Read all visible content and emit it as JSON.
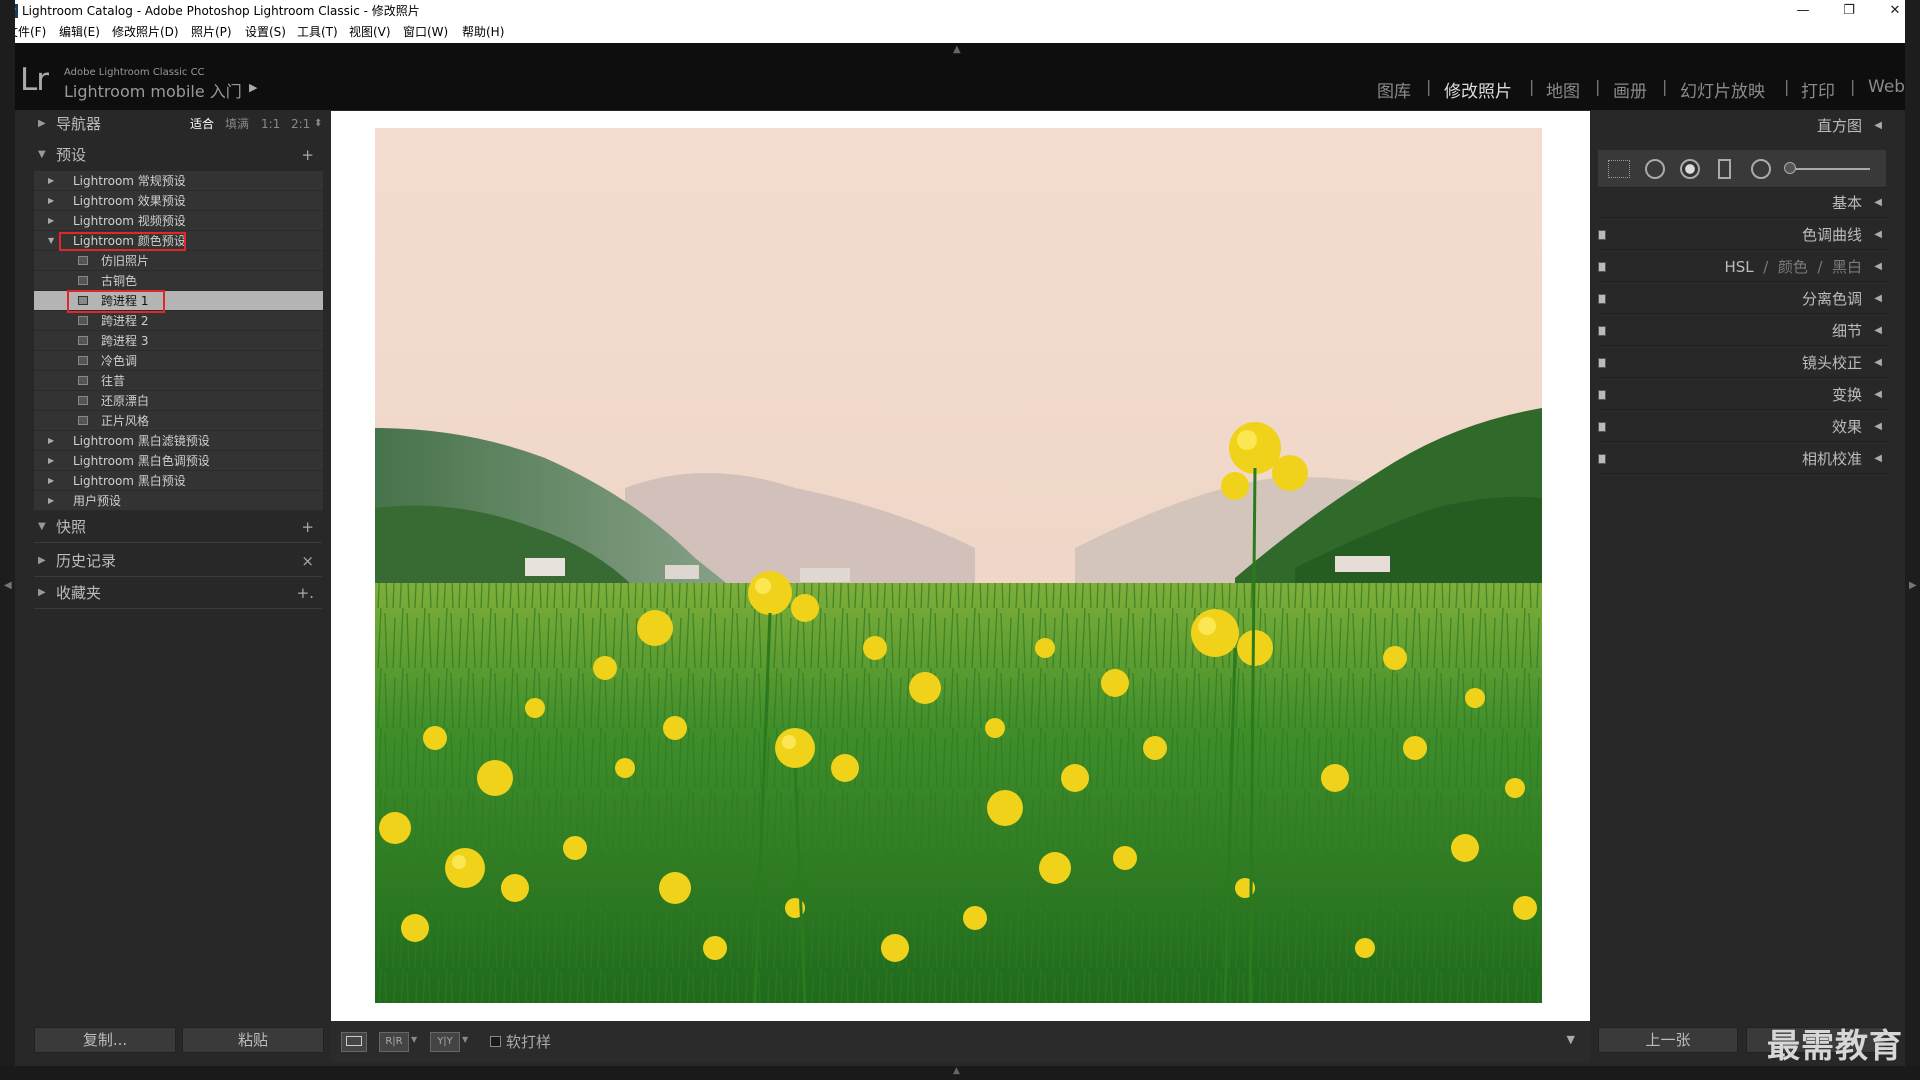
{
  "window": {
    "title": "Lightroom Catalog - Adobe Photoshop Lightroom Classic - 修改照片",
    "minimize_icon": "minimize-icon",
    "restore_icon": "restore-icon",
    "close_icon": "close-icon"
  },
  "menu": [
    "文件(F)",
    "编辑(E)",
    "修改照片(D)",
    "照片(P)",
    "设置(S)",
    "工具(T)",
    "视图(V)",
    "窗口(W)",
    "帮助(H)"
  ],
  "identity": {
    "logo": "Lr",
    "product": "Adobe Lightroom Classic CC",
    "mobile": "Lightroom mobile 入门"
  },
  "modules": [
    "图库",
    "修改照片",
    "地图",
    "画册",
    "幻灯片放映",
    "打印",
    "Web"
  ],
  "active_module": "修改照片",
  "left": {
    "navigator": {
      "label": "导航器",
      "opts": [
        "适合",
        "填满",
        "1:1",
        "2:1"
      ]
    },
    "presets": {
      "label": "预设",
      "add": "+"
    },
    "preset_items": [
      {
        "label": "Lightroom 常规预设",
        "type": "folder"
      },
      {
        "label": "Lightroom 效果预设",
        "type": "folder"
      },
      {
        "label": "Lightroom 视频预设",
        "type": "folder"
      },
      {
        "label": "Lightroom 颜色预设",
        "type": "folder-open",
        "highlight": true
      },
      {
        "label": "仿旧照片",
        "type": "item"
      },
      {
        "label": "古铜色",
        "type": "item"
      },
      {
        "label": "跨进程 1",
        "type": "item",
        "selected": true,
        "highlight": true
      },
      {
        "label": "跨进程 2",
        "type": "item"
      },
      {
        "label": "跨进程 3",
        "type": "item"
      },
      {
        "label": "冷色调",
        "type": "item"
      },
      {
        "label": "往昔",
        "type": "item"
      },
      {
        "label": "还原漂白",
        "type": "item"
      },
      {
        "label": "正片风格",
        "type": "item"
      },
      {
        "label": "Lightroom 黑白滤镜预设",
        "type": "folder"
      },
      {
        "label": "Lightroom 黑白色调预设",
        "type": "folder"
      },
      {
        "label": "Lightroom 黑白预设",
        "type": "folder"
      },
      {
        "label": "用户预设",
        "type": "folder"
      }
    ],
    "snapshots": {
      "label": "快照",
      "add": "+"
    },
    "history": {
      "label": "历史记录",
      "clear": "×"
    },
    "collections": {
      "label": "收藏夹",
      "add": "+."
    },
    "copy_button": "复制...",
    "paste_button": "粘贴"
  },
  "right": {
    "panels": [
      {
        "label": "直方图",
        "switch": false
      },
      {
        "label": "基本",
        "switch": false
      },
      {
        "label": "色调曲线",
        "switch": true
      },
      {
        "label": "HSL",
        "switch": true,
        "extra": [
          "颜色",
          "黑白"
        ]
      },
      {
        "label": "分离色调",
        "switch": true
      },
      {
        "label": "细节",
        "switch": true
      },
      {
        "label": "镜头校正",
        "switch": true
      },
      {
        "label": "变换",
        "switch": true
      },
      {
        "label": "效果",
        "switch": true
      },
      {
        "label": "相机校准",
        "switch": true
      }
    ],
    "prev_button": "上一张"
  },
  "toolbar": {
    "view_loupe": "loupe-view-icon",
    "before_after": "R|R",
    "before_after_y": "Y|Y",
    "soft_proof": "软打样"
  },
  "watermark": "最需教育"
}
